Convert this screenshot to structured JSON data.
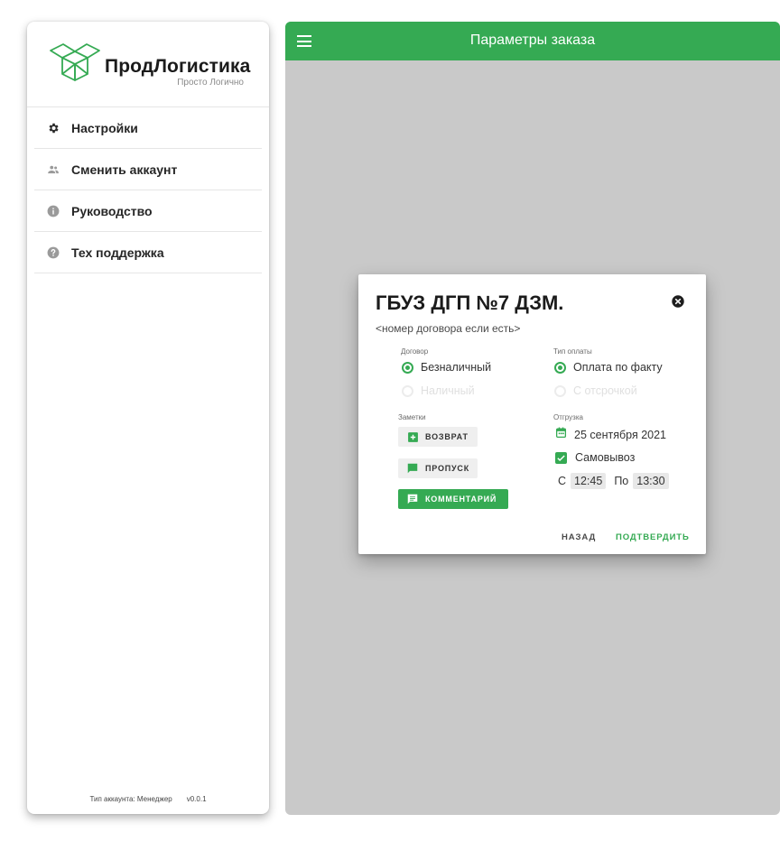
{
  "sidebar": {
    "logo": {
      "name": "ПродЛогистика",
      "tagline": "Просто Логично"
    },
    "menu": [
      {
        "label": "Настройки",
        "icon": "gear-icon"
      },
      {
        "label": "Сменить аккаунт",
        "icon": "people-icon"
      },
      {
        "label": "Руководство",
        "icon": "info-icon"
      },
      {
        "label": "Тех поддержка",
        "icon": "help-icon"
      }
    ],
    "footer": {
      "account_type": "Тип аккаунта: Менеджер",
      "version": "v0.0.1"
    }
  },
  "appbar": {
    "title": "Параметры заказа",
    "menu_icon": "hamburger-menu-icon"
  },
  "dialog": {
    "title": "ГБУЗ ДГП №7 ДЗМ.",
    "subtitle": "<номер договора если есть>",
    "contract": {
      "caption": "Договор",
      "options": [
        {
          "label": "Безналичный",
          "selected": true,
          "disabled": false
        },
        {
          "label": "Наличный",
          "selected": false,
          "disabled": true
        }
      ]
    },
    "payment": {
      "caption": "Тип оплаты",
      "options": [
        {
          "label": "Оплата по факту",
          "selected": true,
          "disabled": false
        },
        {
          "label": "С отсрочкой",
          "selected": false,
          "disabled": true
        }
      ]
    },
    "notes": {
      "caption": "Заметки",
      "buttons": [
        {
          "label": "ВОЗВРАТ",
          "icon": "add-box-icon",
          "active": false
        },
        {
          "label": "ПРОПУСК",
          "icon": "message-icon",
          "active": false
        },
        {
          "label": "КОММЕНТАРИЙ",
          "icon": "comment-icon",
          "active": true
        }
      ]
    },
    "shipment": {
      "caption": "Отгрузка",
      "date": "25 сентября 2021",
      "pickup_label": "Самовывоз",
      "pickup_checked": true,
      "from_label": "С",
      "from_time": "12:45",
      "to_label": "По",
      "to_time": "13:30"
    },
    "actions": {
      "back": "НАЗАД",
      "confirm": "ПОДТВЕРДИТЬ"
    }
  },
  "colors": {
    "accent": "#35aa53",
    "background": "#c9c9c9",
    "disabled": "#e0e0e0"
  }
}
